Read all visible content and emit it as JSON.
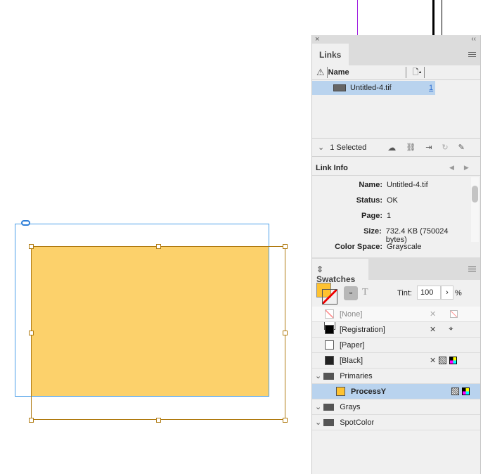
{
  "links": {
    "tab": "Links",
    "col_name": "Name",
    "rows": [
      {
        "name": "Untitled-4.tif",
        "page": "1"
      }
    ],
    "selected": "1 Selected"
  },
  "link_info": {
    "title": "Link Info",
    "fields": [
      {
        "k": "Name:",
        "v": "Untitled-4.tif"
      },
      {
        "k": "Status:",
        "v": "OK"
      },
      {
        "k": "Page:",
        "v": "1"
      },
      {
        "k": "Size:",
        "v": "732.4 KB (750024 bytes)"
      },
      {
        "k": "Color Space:",
        "v": "Grayscale"
      }
    ]
  },
  "swatches": {
    "tab": "Swatches",
    "tint_label": "Tint:",
    "tint_value": "100",
    "pct": "%",
    "T": "T",
    "items": [
      "[None]",
      "[Registration]",
      "[Paper]",
      "[Black]"
    ],
    "groups": [
      "Primaries",
      "Grays",
      "SpotColor"
    ],
    "process": "ProcessY"
  },
  "colors": {
    "fill": "#fcd16b",
    "accent": "#fec230",
    "selection": "#b9d3ee"
  }
}
